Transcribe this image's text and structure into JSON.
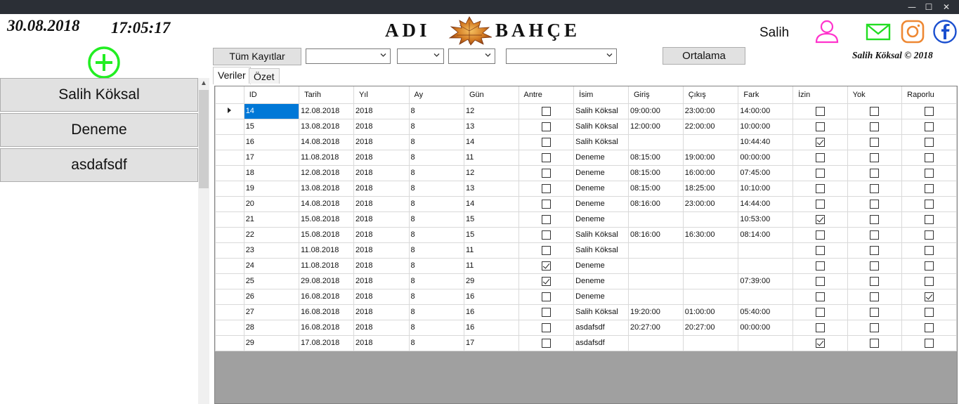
{
  "window": {
    "controls": {
      "minimize": "—",
      "maximize": "☐",
      "close": "✕"
    }
  },
  "header": {
    "date": "30.08.2018",
    "time": "17:05:17",
    "logo_left": "ADI",
    "logo_right": "BAHÇE",
    "username": "Salih",
    "copyright": "Salih Köksal © 2018",
    "icons": [
      "user-icon",
      "mail-icon",
      "instagram-icon",
      "facebook-icon"
    ],
    "colors": {
      "user": "#ff33cc",
      "mail": "#22dd22",
      "instagram": "#ee8833",
      "facebook": "#1a4fcf",
      "add": "#22ee22",
      "selection": "#0078d7"
    }
  },
  "sidebar": {
    "users": [
      "Salih Köksal",
      "Deneme",
      "asdafsdf"
    ]
  },
  "toolbar": {
    "all_records_label": "Tüm Kayıtlar",
    "average_label": "Ortalama",
    "filters": {
      "name": "",
      "year": "",
      "month": "",
      "employee": ""
    }
  },
  "tabs": {
    "data": "Veriler",
    "summary": "Özet"
  },
  "grid": {
    "columns": [
      "ID",
      "Tarih",
      "Yıl",
      "Ay",
      "Gün",
      "Antre",
      "İsim",
      "Giriş",
      "Çıkış",
      "Fark",
      "İzin",
      "Yok",
      "Raporlu"
    ],
    "rows": [
      {
        "id": "14",
        "tarih": "12.08.2018",
        "yil": "2018",
        "ay": "8",
        "gun": "12",
        "antre": false,
        "isim": "Salih Köksal",
        "giris": "09:00:00",
        "cikis": "23:00:00",
        "fark": "14:00:00",
        "izin": false,
        "yok": false,
        "raporlu": false
      },
      {
        "id": "15",
        "tarih": "13.08.2018",
        "yil": "2018",
        "ay": "8",
        "gun": "13",
        "antre": false,
        "isim": "Salih Köksal",
        "giris": "12:00:00",
        "cikis": "22:00:00",
        "fark": "10:00:00",
        "izin": false,
        "yok": false,
        "raporlu": false
      },
      {
        "id": "16",
        "tarih": "14.08.2018",
        "yil": "2018",
        "ay": "8",
        "gun": "14",
        "antre": false,
        "isim": "Salih Köksal",
        "giris": "",
        "cikis": "",
        "fark": "10:44:40",
        "izin": true,
        "yok": false,
        "raporlu": false
      },
      {
        "id": "17",
        "tarih": "11.08.2018",
        "yil": "2018",
        "ay": "8",
        "gun": "11",
        "antre": false,
        "isim": "Deneme",
        "giris": "08:15:00",
        "cikis": "19:00:00",
        "fark": "00:00:00",
        "izin": false,
        "yok": false,
        "raporlu": false
      },
      {
        "id": "18",
        "tarih": "12.08.2018",
        "yil": "2018",
        "ay": "8",
        "gun": "12",
        "antre": false,
        "isim": "Deneme",
        "giris": "08:15:00",
        "cikis": "16:00:00",
        "fark": "07:45:00",
        "izin": false,
        "yok": false,
        "raporlu": false
      },
      {
        "id": "19",
        "tarih": "13.08.2018",
        "yil": "2018",
        "ay": "8",
        "gun": "13",
        "antre": false,
        "isim": "Deneme",
        "giris": "08:15:00",
        "cikis": "18:25:00",
        "fark": "10:10:00",
        "izin": false,
        "yok": false,
        "raporlu": false
      },
      {
        "id": "20",
        "tarih": "14.08.2018",
        "yil": "2018",
        "ay": "8",
        "gun": "14",
        "antre": false,
        "isim": "Deneme",
        "giris": "08:16:00",
        "cikis": "23:00:00",
        "fark": "14:44:00",
        "izin": false,
        "yok": false,
        "raporlu": false
      },
      {
        "id": "21",
        "tarih": "15.08.2018",
        "yil": "2018",
        "ay": "8",
        "gun": "15",
        "antre": false,
        "isim": "Deneme",
        "giris": "",
        "cikis": "",
        "fark": "10:53:00",
        "izin": true,
        "yok": false,
        "raporlu": false
      },
      {
        "id": "22",
        "tarih": "15.08.2018",
        "yil": "2018",
        "ay": "8",
        "gun": "15",
        "antre": false,
        "isim": "Salih Köksal",
        "giris": "08:16:00",
        "cikis": "16:30:00",
        "fark": "08:14:00",
        "izin": false,
        "yok": false,
        "raporlu": false
      },
      {
        "id": "23",
        "tarih": "11.08.2018",
        "yil": "2018",
        "ay": "8",
        "gun": "11",
        "antre": false,
        "isim": "Salih Köksal",
        "giris": "",
        "cikis": "",
        "fark": "",
        "izin": false,
        "yok": false,
        "raporlu": false
      },
      {
        "id": "24",
        "tarih": "11.08.2018",
        "yil": "2018",
        "ay": "8",
        "gun": "11",
        "antre": true,
        "isim": "Deneme",
        "giris": "",
        "cikis": "",
        "fark": "",
        "izin": false,
        "yok": false,
        "raporlu": false
      },
      {
        "id": "25",
        "tarih": "29.08.2018",
        "yil": "2018",
        "ay": "8",
        "gun": "29",
        "antre": true,
        "isim": "Deneme",
        "giris": "",
        "cikis": "",
        "fark": "07:39:00",
        "izin": false,
        "yok": false,
        "raporlu": false
      },
      {
        "id": "26",
        "tarih": "16.08.2018",
        "yil": "2018",
        "ay": "8",
        "gun": "16",
        "antre": false,
        "isim": "Deneme",
        "giris": "",
        "cikis": "",
        "fark": "",
        "izin": false,
        "yok": false,
        "raporlu": true
      },
      {
        "id": "27",
        "tarih": "16.08.2018",
        "yil": "2018",
        "ay": "8",
        "gun": "16",
        "antre": false,
        "isim": "Salih Köksal",
        "giris": "19:20:00",
        "cikis": "01:00:00",
        "fark": "05:40:00",
        "izin": false,
        "yok": false,
        "raporlu": false
      },
      {
        "id": "28",
        "tarih": "16.08.2018",
        "yil": "2018",
        "ay": "8",
        "gun": "16",
        "antre": false,
        "isim": "asdafsdf",
        "giris": "20:27:00",
        "cikis": "20:27:00",
        "fark": "00:00:00",
        "izin": false,
        "yok": false,
        "raporlu": false
      },
      {
        "id": "29",
        "tarih": "17.08.2018",
        "yil": "2018",
        "ay": "8",
        "gun": "17",
        "antre": false,
        "isim": "asdafsdf",
        "giris": "",
        "cikis": "",
        "fark": "",
        "izin": true,
        "yok": false,
        "raporlu": false
      }
    ]
  }
}
